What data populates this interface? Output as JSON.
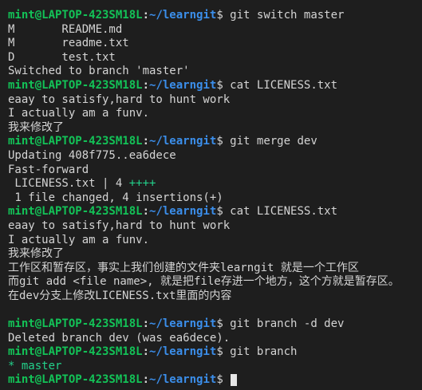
{
  "prompt": {
    "user": "mint@LAPTOP-423SM18L",
    "sep": ":",
    "path": "~/learngit",
    "symbol": "$"
  },
  "colors": {
    "background": "#1e1e1e",
    "text": "#d4d4d4",
    "user": "#13c257",
    "path": "#3b8eea",
    "added": "#23d18b"
  },
  "lines": [
    {
      "type": "prompt",
      "cmd": " git switch master"
    },
    {
      "type": "out",
      "text": "M       README.md"
    },
    {
      "type": "out",
      "text": "M       readme.txt"
    },
    {
      "type": "out",
      "text": "D       test.txt"
    },
    {
      "type": "out",
      "text": "Switched to branch 'master'"
    },
    {
      "type": "prompt",
      "cmd": " cat LICENESS.txt"
    },
    {
      "type": "out",
      "text": "eaay to satisfy,hard to hunt work"
    },
    {
      "type": "out",
      "text": "I actually am a funv."
    },
    {
      "type": "out",
      "text": "我来修改了"
    },
    {
      "type": "prompt",
      "cmd": " git merge dev"
    },
    {
      "type": "out",
      "text": "Updating 408f775..ea6dece"
    },
    {
      "type": "out",
      "text": "Fast-forward"
    },
    {
      "type": "diffstat",
      "text": " LICENESS.txt | 4 ",
      "plus": "++++"
    },
    {
      "type": "out",
      "text": " 1 file changed, 4 insertions(+)"
    },
    {
      "type": "prompt",
      "cmd": " cat LICENESS.txt"
    },
    {
      "type": "out",
      "text": "eaay to satisfy,hard to hunt work"
    },
    {
      "type": "out",
      "text": "I actually am a funv."
    },
    {
      "type": "out",
      "text": "我来修改了"
    },
    {
      "type": "out",
      "text": "工作区和暂存区，事实上我们创建的文件夹learngit 就是一个工作区"
    },
    {
      "type": "out",
      "text": "而git add <file name>, 就是把file存进一个地方，这个方就是暂存区。"
    },
    {
      "type": "out",
      "text": "在dev分支上修改LICENESS.txt里面的内容"
    },
    {
      "type": "blank",
      "text": ""
    },
    {
      "type": "prompt",
      "cmd": " git branch -d dev"
    },
    {
      "type": "out",
      "text": "Deleted branch dev (was ea6dece)."
    },
    {
      "type": "prompt",
      "cmd": " git branch"
    },
    {
      "type": "branch",
      "text": "* master"
    },
    {
      "type": "prompt-cursor",
      "cmd": " "
    }
  ]
}
